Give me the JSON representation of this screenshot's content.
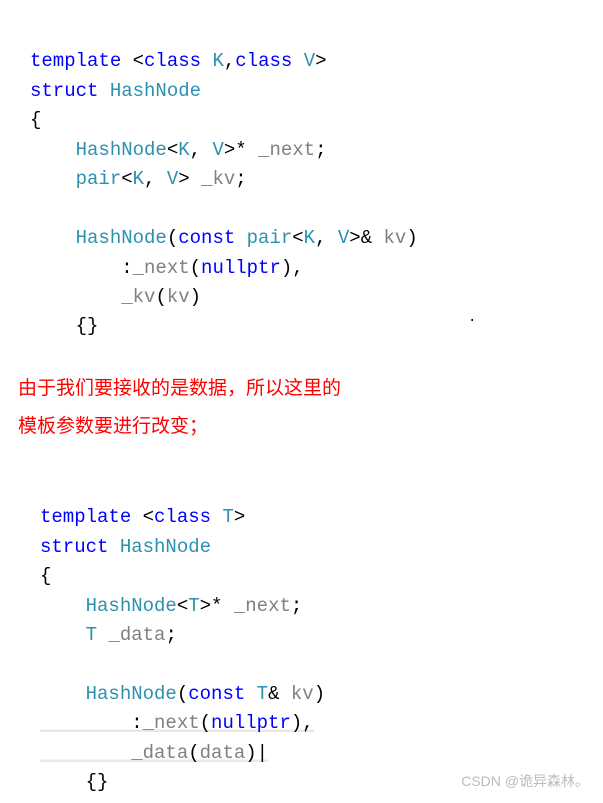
{
  "code1": {
    "l1_kw1": "template",
    "l1_lt": " <",
    "l1_kw2": "class",
    "l1_sp1": " ",
    "l1_t1": "K",
    "l1_comma": ",",
    "l1_kw3": "class",
    "l1_sp2": " ",
    "l1_t2": "V",
    "l1_gt": ">",
    "l2_kw": "struct",
    "l2_sp": " ",
    "l2_name": "HashNode",
    "l3": "{",
    "l4_indent": "    ",
    "l4_cls": "HashNode",
    "l4_lt": "<",
    "l4_t1": "K",
    "l4_c1": ", ",
    "l4_t2": "V",
    "l4_gt": ">* ",
    "l4_var": "_next",
    "l4_semi": ";",
    "l5_indent": "    ",
    "l5_cls": "pair",
    "l5_lt": "<",
    "l5_t1": "K",
    "l5_c1": ", ",
    "l5_t2": "V",
    "l5_gt": "> ",
    "l5_var": "_kv",
    "l5_semi": ";",
    "l6_indent": "    ",
    "l6_cls": "HashNode",
    "l6_op": "(",
    "l6_kw": "const",
    "l6_sp": " ",
    "l6_cls2": "pair",
    "l6_lt": "<",
    "l6_t1": "K",
    "l6_c1": ", ",
    "l6_t2": "V",
    "l6_gt": ">& ",
    "l6_var": "kv",
    "l6_cp": ")",
    "l7_indent": "        :",
    "l7_var": "_next",
    "l7_op": "(",
    "l7_kw": "nullptr",
    "l7_cp": "),",
    "l8_indent": "        ",
    "l8_var": "_kv",
    "l8_op": "(",
    "l8_arg": "kv",
    "l8_cp": ")",
    "l9_indent": "    {}"
  },
  "comment": {
    "line1": "由于我们要接收的是数据，所以这里的",
    "line2": "模板参数要进行改变；"
  },
  "code2": {
    "l1_kw1": "template",
    "l1_lt": " <",
    "l1_kw2": "class",
    "l1_sp1": " ",
    "l1_t1": "T",
    "l1_gt": ">",
    "l2_kw": "struct",
    "l2_sp": " ",
    "l2_name": "HashNode",
    "l3": "{",
    "l4_indent": "    ",
    "l4_cls": "HashNode",
    "l4_lt": "<",
    "l4_t1": "T",
    "l4_gt": ">* ",
    "l4_var": "_next",
    "l4_semi": ";",
    "l5_indent": "    ",
    "l5_t": "T",
    "l5_sp": " ",
    "l5_var": "_data",
    "l5_semi": ";",
    "l6_indent": "    ",
    "l6_cls": "HashNode",
    "l6_op": "(",
    "l6_kw": "const",
    "l6_sp": " ",
    "l6_t": "T",
    "l6_amp": "& ",
    "l6_var": "kv",
    "l6_cp": ")",
    "l7_indent": "        :",
    "l7_var": "_next",
    "l7_op": "(",
    "l7_kw": "nullptr",
    "l7_cp": "),",
    "l8_indent": "        ",
    "l8_var": "_data",
    "l8_op": "(",
    "l8_arg": "data",
    "l8_cp": ")",
    "l9_indent": "    {}"
  },
  "watermark": "CSDN @诡异森林。",
  "dot": "."
}
